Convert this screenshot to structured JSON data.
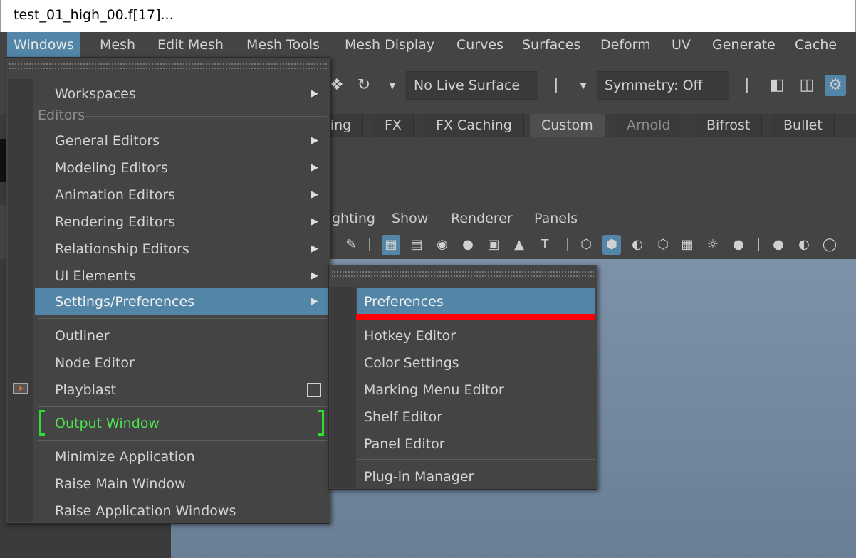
{
  "title_bar": {
    "text": "test_01_high_00.f[17]..."
  },
  "menubar": {
    "items": [
      "Windows",
      "Mesh",
      "Edit Mesh",
      "Mesh Tools",
      "Mesh Display",
      "Curves",
      "Surfaces",
      "Deform",
      "UV",
      "Generate",
      "Cache"
    ],
    "active": "Windows"
  },
  "toolbar": {
    "live_surface": "No Live Surface",
    "symmetry": "Symmetry: Off"
  },
  "shelf_tabs": {
    "items": [
      "ring",
      "FX",
      "FX Caching",
      "Custom",
      "Arnold",
      "Bifrost",
      "Bullet"
    ],
    "active": "Custom"
  },
  "panel_menu": {
    "items": [
      "ghting",
      "Show",
      "Renderer",
      "Panels"
    ]
  },
  "windows_menu": {
    "workspaces": "Workspaces",
    "section_editors": "Editors",
    "general_editors": "General Editors",
    "modeling_editors": "Modeling Editors",
    "animation_editors": "Animation Editors",
    "rendering_editors": "Rendering Editors",
    "relationship_editors": "Relationship Editors",
    "ui_elements": "UI Elements",
    "settings_preferences": "Settings/Preferences",
    "outliner": "Outliner",
    "node_editor": "Node Editor",
    "playblast": "Playblast",
    "output_window": "Output Window",
    "minimize_application": "Minimize Application",
    "raise_main_window": "Raise Main Window",
    "raise_application_windows": "Raise Application Windows"
  },
  "settings_submenu": {
    "preferences": "Preferences",
    "hotkey_editor": "Hotkey Editor",
    "color_settings": "Color Settings",
    "marking_menu_editor": "Marking Menu Editor",
    "shelf_editor": "Shelf Editor",
    "panel_editor": "Panel Editor",
    "plugin_manager": "Plug-in Manager"
  },
  "colors": {
    "highlight": "#5285a6",
    "annotation_underline": "#ff0000",
    "output_window_text": "#4fe04f"
  }
}
